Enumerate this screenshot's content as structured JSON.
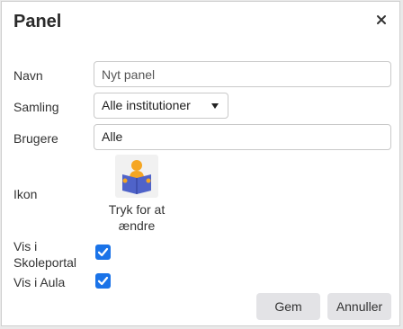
{
  "dialog": {
    "title": "Panel",
    "close_icon": "close-icon"
  },
  "form": {
    "name": {
      "label": "Navn",
      "placeholder": "Nyt panel",
      "value": ""
    },
    "collection": {
      "label": "Samling",
      "selected": "Alle institutioner"
    },
    "users": {
      "label": "Brugere",
      "value": "Alle"
    },
    "icon": {
      "label": "Ikon",
      "icon_name": "reading-child-icon",
      "caption_line1": "Tryk for at",
      "caption_line2": "ændre"
    },
    "show_school_portal": {
      "label_line1": "Vis i",
      "label_line2": "Skoleportal",
      "checked": true
    },
    "show_aula": {
      "label": "Vis i Aula",
      "checked": true
    }
  },
  "buttons": {
    "save": "Gem",
    "cancel": "Annuller"
  },
  "colors": {
    "accent": "#1a73e8",
    "button_bg": "#e3e3e6"
  }
}
